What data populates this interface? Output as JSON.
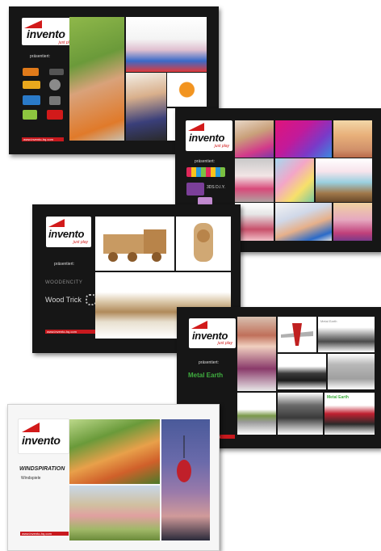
{
  "catalogs": [
    {
      "logo_word": "invento",
      "logo_tagline": "just play",
      "presents_label": "präsentiert:",
      "footer_url": "www.invento-hq.com"
    },
    {
      "logo_word": "invento",
      "logo_tagline": "just play",
      "presents_label": "präsentiert:",
      "brand_label": "3DS D.I.Y."
    },
    {
      "logo_word": "invento",
      "logo_tagline": "just play",
      "presents_label": "präsentiert:",
      "brand_1": "WOODENCITY",
      "brand_2": "Wood Trick",
      "footer_url": "www.invento-hq.com"
    },
    {
      "logo_word": "invento",
      "logo_tagline": "just play",
      "presents_label": "präsentiert:",
      "brand_label": "Metal Earth",
      "footer_url": "www.invento-hq.com",
      "tile_label_1": "Metal Earth",
      "tile_label_2": "Metal Earth"
    },
    {
      "logo_word": "invento",
      "brand_label": "WINDSPIRATION",
      "brand_sub": "Windspiele",
      "footer_url": "www.invento-hq.com"
    }
  ],
  "colors": {
    "brand_red": "#c8191e",
    "dark_bg": "#161616",
    "metal_green": "#3fae3f"
  }
}
